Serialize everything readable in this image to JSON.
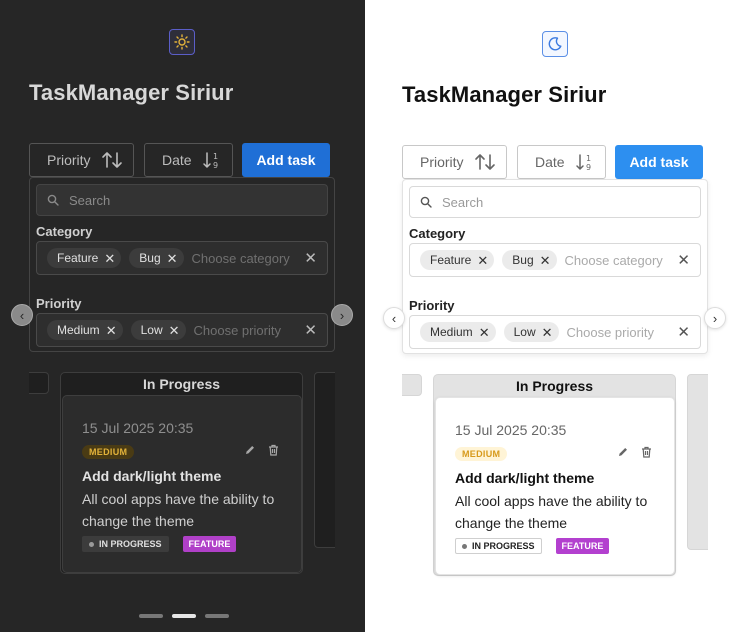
{
  "app": {
    "title": "TaskManager Siriur"
  },
  "themes": {
    "dark": {
      "toggle_icon": "sun-icon"
    },
    "light": {
      "toggle_icon": "moon-icon"
    }
  },
  "toolbar": {
    "sort_priority_label": "Priority",
    "sort_date_label": "Date",
    "add_task_label": "Add task"
  },
  "filters": {
    "search_placeholder": "Search",
    "category_label": "Category",
    "category_chips": [
      "Feature",
      "Bug"
    ],
    "category_placeholder": "Choose category",
    "priority_label": "Priority",
    "priority_chips": [
      "Medium",
      "Low"
    ],
    "priority_placeholder": "Choose priority"
  },
  "board": {
    "column_title": "In Progress",
    "card": {
      "date": "15 Jul 2025 20:35",
      "priority": "MEDIUM",
      "title": "Add dark/light theme",
      "description": "All cool apps have the ability to change the theme",
      "status": "IN PROGRESS",
      "category": "FEATURE"
    }
  },
  "pager": {
    "count": 3,
    "active_index": 1
  },
  "colors": {
    "dark_bg": "#262626",
    "light_bg": "#ffffff",
    "accent_dark": "#1f6fd6",
    "accent_light": "#2d8ff0",
    "medium_badge": "#d79a1c",
    "feature_tag": "#b340cf"
  }
}
